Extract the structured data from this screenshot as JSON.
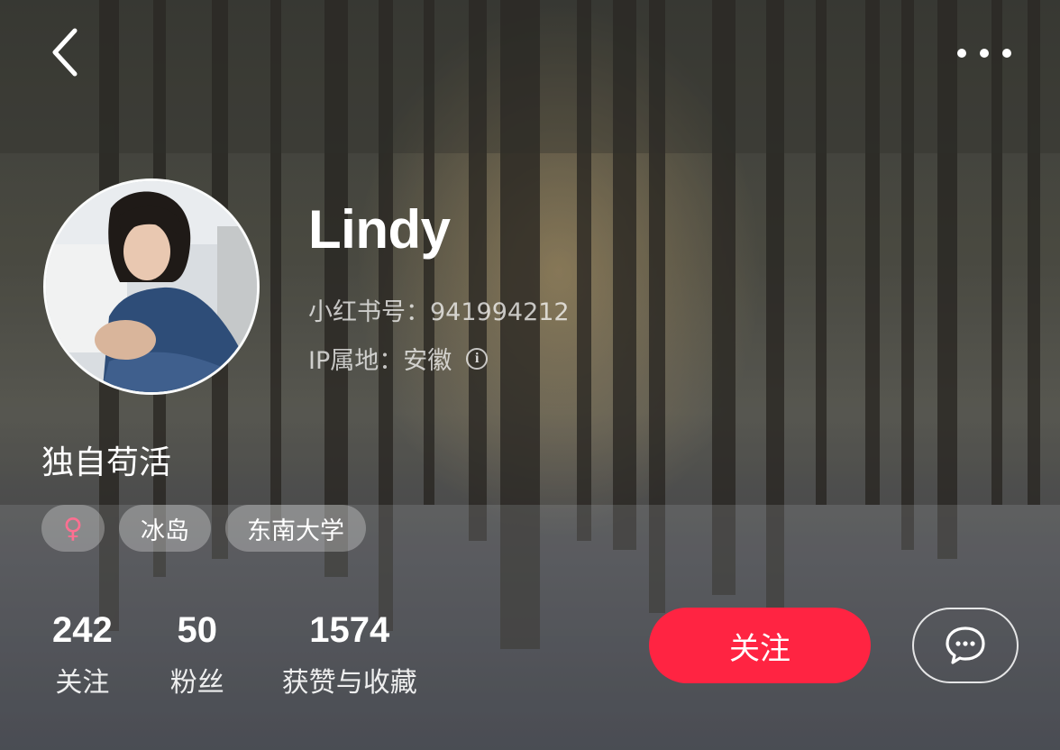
{
  "header": {
    "back_icon": "chevron-left-icon",
    "more_icon": "more-dots-icon"
  },
  "profile": {
    "name": "Lindy",
    "id_text": "小红书号：941994212",
    "ip_text": "IP属地：安徽",
    "info_icon_glyph": "i",
    "bio": "独自苟活"
  },
  "tags": {
    "gender_symbol": "♀",
    "location": "冰岛",
    "school": "东南大学"
  },
  "stats": [
    {
      "num": "242",
      "label": "关注"
    },
    {
      "num": "50",
      "label": "粉丝"
    },
    {
      "num": "1574",
      "label": "获赞与收藏"
    }
  ],
  "actions": {
    "follow_label": "关注",
    "follow_color": "#ff2442",
    "message_icon": "chat-bubble-icon"
  }
}
